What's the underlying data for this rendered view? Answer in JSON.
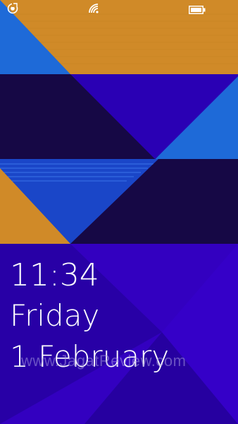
{
  "status_bar": {
    "icons": [
      "signal-icon",
      "wifi-icon",
      "battery-icon"
    ]
  },
  "lock_screen": {
    "time": "11:34",
    "day": "Friday",
    "date": "1 February"
  },
  "watermark": {
    "text": "www.JagatReview.com"
  },
  "colors": {
    "orange": "#d08a28",
    "navy": "#160845",
    "indigo": "#2a00b4",
    "royal": "#3300c0",
    "sky_blue": "#1e6ad8",
    "deep_blue": "#1a3fc4"
  }
}
